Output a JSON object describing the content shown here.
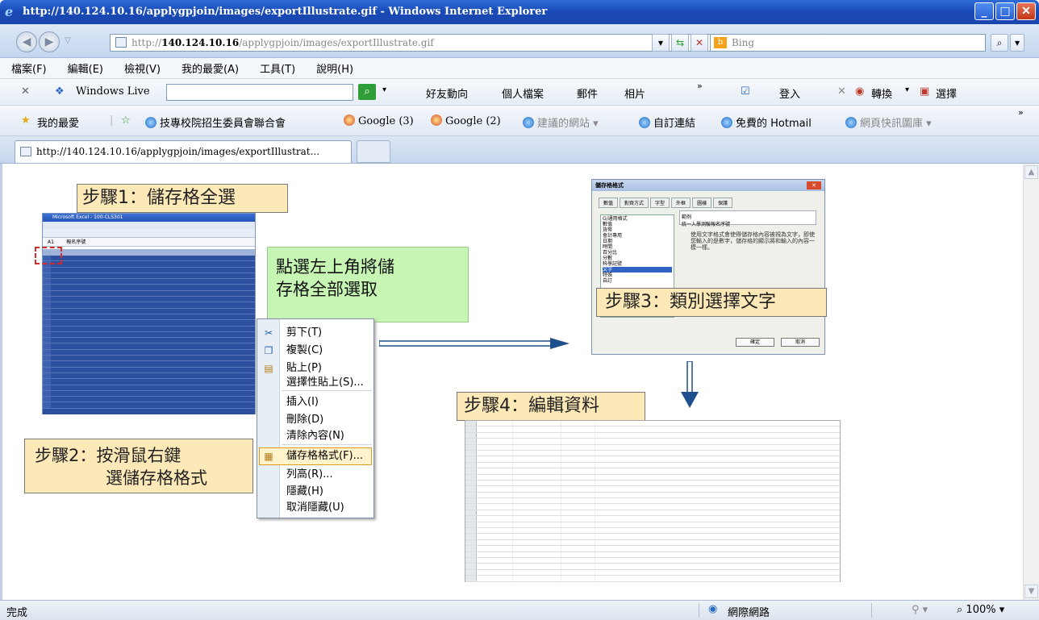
{
  "window": {
    "title": "http://140.124.10.16/applygpjoin/images/exportIllustrate.gif - Windows Internet Explorer"
  },
  "address": {
    "prefix": "http://",
    "host": "140.124.10.16",
    "path": "/applygpjoin/images/exportIllustrate.gif"
  },
  "search": {
    "placeholder": "Bing"
  },
  "menu": [
    "檔案(F)",
    "編輯(E)",
    "檢視(V)",
    "我的最愛(A)",
    "工具(T)",
    "說明(H)"
  ],
  "toolbar2": {
    "live": "Windows Live",
    "links": [
      "好友動向",
      "個人檔案",
      "郵件",
      "相片"
    ],
    "login": "登入",
    "convert": "轉換",
    "select": "選擇"
  },
  "favorites": {
    "label": "我的最愛",
    "items": [
      "技專校院招生委員會聯合會",
      "Google (3)",
      "Google (2)",
      "建議的網站 ▾",
      "自訂連結",
      "免費的 Hotmail",
      "網頁快訊圖庫 ▾"
    ]
  },
  "tab": {
    "title": "http://140.124.10.16/applygpjoin/images/exportIllustrat..."
  },
  "status": {
    "left": "完成",
    "zone": "網際網路",
    "zoom": "100%"
  },
  "illustration": {
    "step1": "步驟1：儲存格全選",
    "step2_line1": "步驟2：按滑鼠右鍵",
    "step2_line2": "選儲存格格式",
    "step3": "步驟3：類別選擇文字",
    "step4": "步驟4：編輯資料",
    "callout_line1": "點選左上角將儲",
    "callout_line2": "存格全部選取",
    "context_menu": [
      "剪下(T)",
      "複製(C)",
      "貼上(P)",
      "選擇性貼上(S)...",
      "插入(I)",
      "刪除(D)",
      "清除內容(N)",
      "儲存格格式(F)...",
      "列高(R)...",
      "隱藏(H)",
      "取消隱藏(U)"
    ],
    "excel_title": "Microsoft Excel - 100-CLS301",
    "excel_cell_ref": "A1",
    "excel_formula": "報名序號",
    "dialog_title": "儲存格格式",
    "dialog_tabs": [
      "數值",
      "對齊方式",
      "字型",
      "外框",
      "圖樣",
      "保護"
    ],
    "dialog_categories": [
      "G/通用格式",
      "數值",
      "貨幣",
      "會計專用",
      "日期",
      "時間",
      "百分比",
      "分數",
      "科學記號",
      "文字",
      "特殊",
      "自訂"
    ],
    "dialog_sample_label": "範例",
    "dialog_sample": "統一入學測驗報名序號",
    "dialog_note": "使用文字格式會使得儲存格內容被視為文字，即使您輸入的是數字，儲存格的顯示將和輸入的內容一模一樣。",
    "dialog_ok": "確定",
    "dialog_cancel": "取消"
  }
}
